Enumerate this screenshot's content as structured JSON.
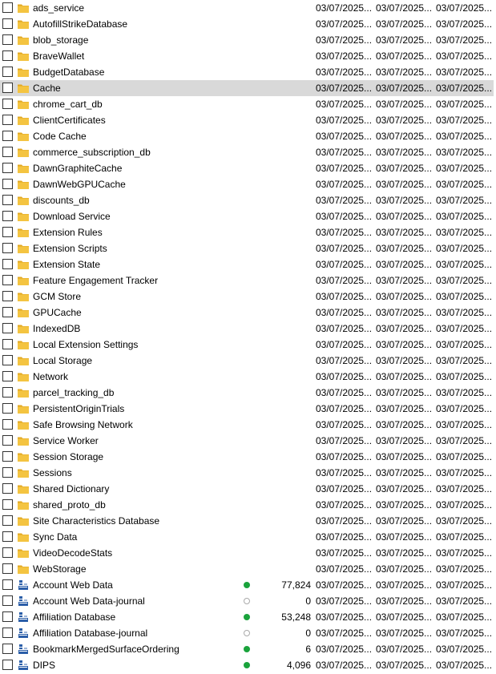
{
  "colors": {
    "synced": "#1aa33c",
    "pending_border": "#aaaaaa",
    "folder_body": "#f4c441",
    "folder_tab": "#e2a823",
    "file_icon": "#2b5ea8"
  },
  "selected_index": 5,
  "rows": [
    {
      "name": "ads_service",
      "type": "folder",
      "dates": [
        "03/07/2025...",
        "03/07/2025...",
        "03/07/2025..."
      ]
    },
    {
      "name": "AutofillStrikeDatabase",
      "type": "folder",
      "dates": [
        "03/07/2025...",
        "03/07/2025...",
        "03/07/2025..."
      ]
    },
    {
      "name": "blob_storage",
      "type": "folder",
      "dates": [
        "03/07/2025...",
        "03/07/2025...",
        "03/07/2025..."
      ]
    },
    {
      "name": "BraveWallet",
      "type": "folder",
      "dates": [
        "03/07/2025...",
        "03/07/2025...",
        "03/07/2025..."
      ]
    },
    {
      "name": "BudgetDatabase",
      "type": "folder",
      "dates": [
        "03/07/2025...",
        "03/07/2025...",
        "03/07/2025..."
      ]
    },
    {
      "name": "Cache",
      "type": "folder",
      "dates": [
        "03/07/2025...",
        "03/07/2025...",
        "03/07/2025..."
      ]
    },
    {
      "name": "chrome_cart_db",
      "type": "folder",
      "dates": [
        "03/07/2025...",
        "03/07/2025...",
        "03/07/2025..."
      ]
    },
    {
      "name": "ClientCertificates",
      "type": "folder",
      "dates": [
        "03/07/2025...",
        "03/07/2025...",
        "03/07/2025..."
      ]
    },
    {
      "name": "Code Cache",
      "type": "folder",
      "dates": [
        "03/07/2025...",
        "03/07/2025...",
        "03/07/2025..."
      ]
    },
    {
      "name": "commerce_subscription_db",
      "type": "folder",
      "dates": [
        "03/07/2025...",
        "03/07/2025...",
        "03/07/2025..."
      ]
    },
    {
      "name": "DawnGraphiteCache",
      "type": "folder",
      "dates": [
        "03/07/2025...",
        "03/07/2025...",
        "03/07/2025..."
      ]
    },
    {
      "name": "DawnWebGPUCache",
      "type": "folder",
      "dates": [
        "03/07/2025...",
        "03/07/2025...",
        "03/07/2025..."
      ]
    },
    {
      "name": "discounts_db",
      "type": "folder",
      "dates": [
        "03/07/2025...",
        "03/07/2025...",
        "03/07/2025..."
      ]
    },
    {
      "name": "Download Service",
      "type": "folder",
      "dates": [
        "03/07/2025...",
        "03/07/2025...",
        "03/07/2025..."
      ]
    },
    {
      "name": "Extension Rules",
      "type": "folder",
      "dates": [
        "03/07/2025...",
        "03/07/2025...",
        "03/07/2025..."
      ]
    },
    {
      "name": "Extension Scripts",
      "type": "folder",
      "dates": [
        "03/07/2025...",
        "03/07/2025...",
        "03/07/2025..."
      ]
    },
    {
      "name": "Extension State",
      "type": "folder",
      "dates": [
        "03/07/2025...",
        "03/07/2025...",
        "03/07/2025..."
      ]
    },
    {
      "name": "Feature Engagement Tracker",
      "type": "folder",
      "dates": [
        "03/07/2025...",
        "03/07/2025...",
        "03/07/2025..."
      ]
    },
    {
      "name": "GCM Store",
      "type": "folder",
      "dates": [
        "03/07/2025...",
        "03/07/2025...",
        "03/07/2025..."
      ]
    },
    {
      "name": "GPUCache",
      "type": "folder",
      "dates": [
        "03/07/2025...",
        "03/07/2025...",
        "03/07/2025..."
      ]
    },
    {
      "name": "IndexedDB",
      "type": "folder",
      "dates": [
        "03/07/2025...",
        "03/07/2025...",
        "03/07/2025..."
      ]
    },
    {
      "name": "Local Extension Settings",
      "type": "folder",
      "dates": [
        "03/07/2025...",
        "03/07/2025...",
        "03/07/2025..."
      ]
    },
    {
      "name": "Local Storage",
      "type": "folder",
      "dates": [
        "03/07/2025...",
        "03/07/2025...",
        "03/07/2025..."
      ]
    },
    {
      "name": "Network",
      "type": "folder",
      "dates": [
        "03/07/2025...",
        "03/07/2025...",
        "03/07/2025..."
      ]
    },
    {
      "name": "parcel_tracking_db",
      "type": "folder",
      "dates": [
        "03/07/2025...",
        "03/07/2025...",
        "03/07/2025..."
      ]
    },
    {
      "name": "PersistentOriginTrials",
      "type": "folder",
      "dates": [
        "03/07/2025...",
        "03/07/2025...",
        "03/07/2025..."
      ]
    },
    {
      "name": "Safe Browsing Network",
      "type": "folder",
      "dates": [
        "03/07/2025...",
        "03/07/2025...",
        "03/07/2025..."
      ]
    },
    {
      "name": "Service Worker",
      "type": "folder",
      "dates": [
        "03/07/2025...",
        "03/07/2025...",
        "03/07/2025..."
      ]
    },
    {
      "name": "Session Storage",
      "type": "folder",
      "dates": [
        "03/07/2025...",
        "03/07/2025...",
        "03/07/2025..."
      ]
    },
    {
      "name": "Sessions",
      "type": "folder",
      "dates": [
        "03/07/2025...",
        "03/07/2025...",
        "03/07/2025..."
      ]
    },
    {
      "name": "Shared Dictionary",
      "type": "folder",
      "dates": [
        "03/07/2025...",
        "03/07/2025...",
        "03/07/2025..."
      ]
    },
    {
      "name": "shared_proto_db",
      "type": "folder",
      "dates": [
        "03/07/2025...",
        "03/07/2025...",
        "03/07/2025..."
      ]
    },
    {
      "name": "Site Characteristics Database",
      "type": "folder",
      "dates": [
        "03/07/2025...",
        "03/07/2025...",
        "03/07/2025..."
      ]
    },
    {
      "name": "Sync Data",
      "type": "folder",
      "dates": [
        "03/07/2025...",
        "03/07/2025...",
        "03/07/2025..."
      ]
    },
    {
      "name": "VideoDecodeStats",
      "type": "folder",
      "dates": [
        "03/07/2025...",
        "03/07/2025...",
        "03/07/2025..."
      ]
    },
    {
      "name": "WebStorage",
      "type": "folder",
      "dates": [
        "03/07/2025...",
        "03/07/2025...",
        "03/07/2025..."
      ]
    },
    {
      "name": "Account Web Data",
      "type": "file",
      "status": "synced",
      "size": "77,824",
      "dates": [
        "03/07/2025...",
        "03/07/2025...",
        "03/07/2025..."
      ]
    },
    {
      "name": "Account Web Data-journal",
      "type": "file",
      "status": "pending",
      "size": "0",
      "dates": [
        "03/07/2025...",
        "03/07/2025...",
        "03/07/2025..."
      ]
    },
    {
      "name": "Affiliation Database",
      "type": "file",
      "status": "synced",
      "size": "53,248",
      "dates": [
        "03/07/2025...",
        "03/07/2025...",
        "03/07/2025..."
      ]
    },
    {
      "name": "Affiliation Database-journal",
      "type": "file",
      "status": "pending",
      "size": "0",
      "dates": [
        "03/07/2025...",
        "03/07/2025...",
        "03/07/2025..."
      ]
    },
    {
      "name": "BookmarkMergedSurfaceOrdering",
      "type": "file",
      "status": "synced",
      "size": "6",
      "dates": [
        "03/07/2025...",
        "03/07/2025...",
        "03/07/2025..."
      ]
    },
    {
      "name": "DIPS",
      "type": "file",
      "status": "synced",
      "size": "4,096",
      "dates": [
        "03/07/2025...",
        "03/07/2025...",
        "03/07/2025..."
      ]
    }
  ]
}
